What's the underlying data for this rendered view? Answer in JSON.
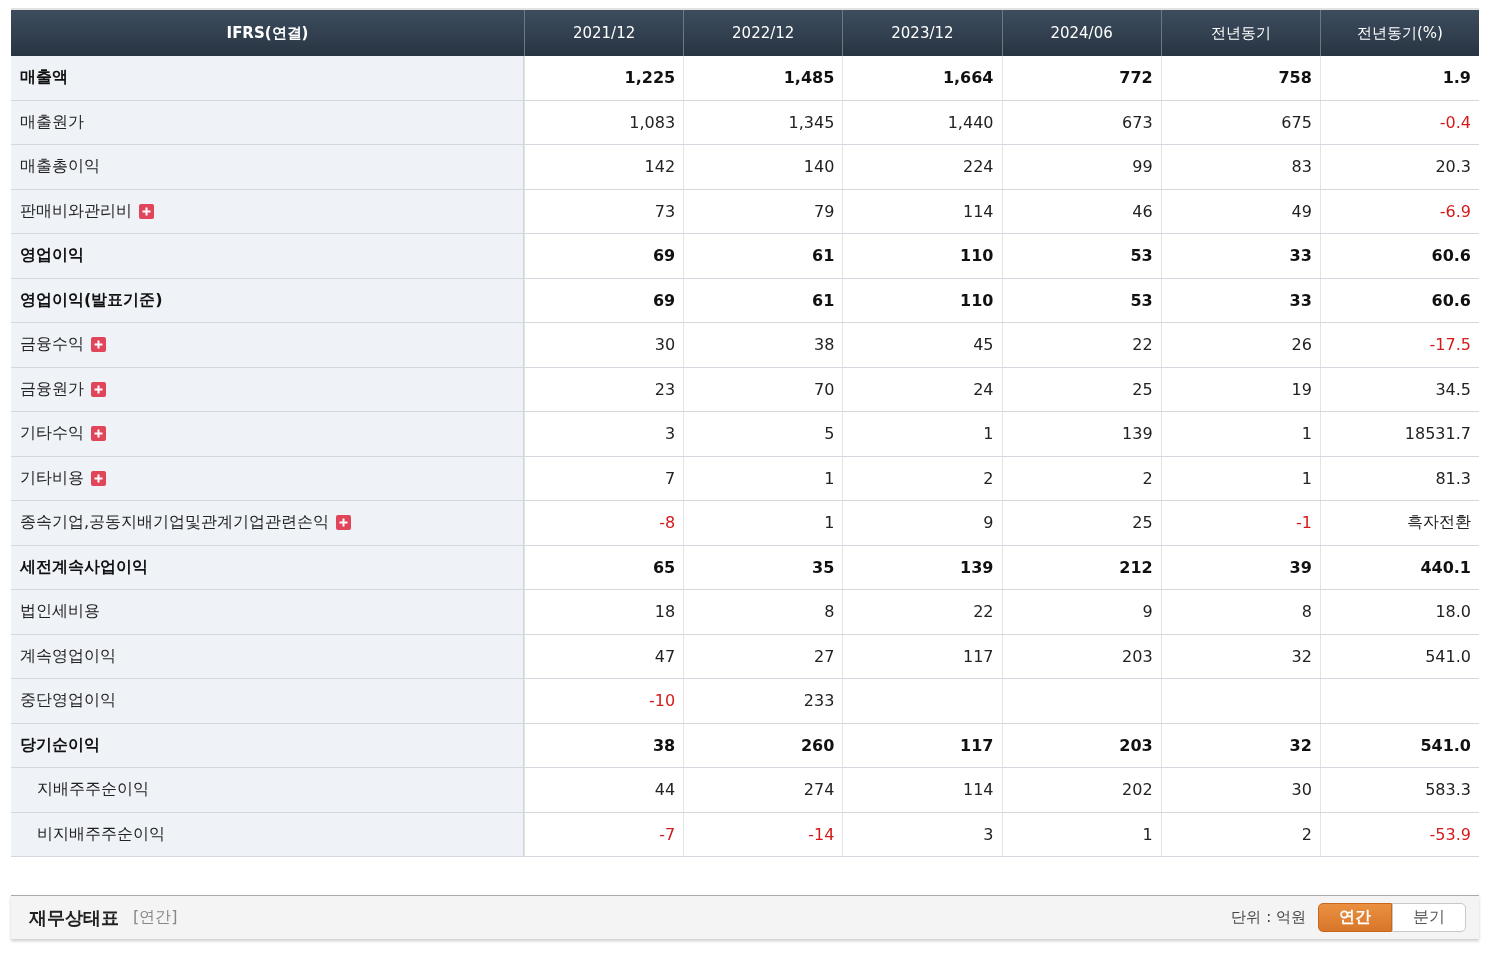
{
  "table": {
    "label_header": "IFRS(연결)",
    "columns": [
      "2021/12",
      "2022/12",
      "2023/12",
      "2024/06",
      "전년동기",
      "전년동기(%)"
    ],
    "rows": [
      {
        "label": "매출액",
        "bold": true,
        "expandable": false,
        "cells": [
          {
            "text": "1,225",
            "negative": false
          },
          {
            "text": "1,485",
            "negative": false
          },
          {
            "text": "1,664",
            "negative": false
          },
          {
            "text": "772",
            "negative": false
          },
          {
            "text": "758",
            "negative": false
          },
          {
            "text": "1.9",
            "negative": false
          }
        ]
      },
      {
        "label": "매출원가",
        "bold": false,
        "expandable": false,
        "cells": [
          {
            "text": "1,083",
            "negative": false
          },
          {
            "text": "1,345",
            "negative": false
          },
          {
            "text": "1,440",
            "negative": false
          },
          {
            "text": "673",
            "negative": false
          },
          {
            "text": "675",
            "negative": false
          },
          {
            "text": "-0.4",
            "negative": true
          }
        ]
      },
      {
        "label": "매출총이익",
        "bold": false,
        "expandable": false,
        "cells": [
          {
            "text": "142",
            "negative": false
          },
          {
            "text": "140",
            "negative": false
          },
          {
            "text": "224",
            "negative": false
          },
          {
            "text": "99",
            "negative": false
          },
          {
            "text": "83",
            "negative": false
          },
          {
            "text": "20.3",
            "negative": false
          }
        ]
      },
      {
        "label": "판매비와관리비",
        "bold": false,
        "expandable": true,
        "cells": [
          {
            "text": "73",
            "negative": false
          },
          {
            "text": "79",
            "negative": false
          },
          {
            "text": "114",
            "negative": false
          },
          {
            "text": "46",
            "negative": false
          },
          {
            "text": "49",
            "negative": false
          },
          {
            "text": "-6.9",
            "negative": true
          }
        ]
      },
      {
        "label": "영업이익",
        "bold": true,
        "expandable": false,
        "cells": [
          {
            "text": "69",
            "negative": false
          },
          {
            "text": "61",
            "negative": false
          },
          {
            "text": "110",
            "negative": false
          },
          {
            "text": "53",
            "negative": false
          },
          {
            "text": "33",
            "negative": false
          },
          {
            "text": "60.6",
            "negative": false
          }
        ]
      },
      {
        "label": "영업이익(발표기준)",
        "bold": true,
        "expandable": false,
        "cells": [
          {
            "text": "69",
            "negative": false
          },
          {
            "text": "61",
            "negative": false
          },
          {
            "text": "110",
            "negative": false
          },
          {
            "text": "53",
            "negative": false
          },
          {
            "text": "33",
            "negative": false
          },
          {
            "text": "60.6",
            "negative": false
          }
        ]
      },
      {
        "label": "금융수익",
        "bold": false,
        "expandable": true,
        "cells": [
          {
            "text": "30",
            "negative": false
          },
          {
            "text": "38",
            "negative": false
          },
          {
            "text": "45",
            "negative": false
          },
          {
            "text": "22",
            "negative": false
          },
          {
            "text": "26",
            "negative": false
          },
          {
            "text": "-17.5",
            "negative": true
          }
        ]
      },
      {
        "label": "금융원가",
        "bold": false,
        "expandable": true,
        "cells": [
          {
            "text": "23",
            "negative": false
          },
          {
            "text": "70",
            "negative": false
          },
          {
            "text": "24",
            "negative": false
          },
          {
            "text": "25",
            "negative": false
          },
          {
            "text": "19",
            "negative": false
          },
          {
            "text": "34.5",
            "negative": false
          }
        ]
      },
      {
        "label": "기타수익",
        "bold": false,
        "expandable": true,
        "cells": [
          {
            "text": "3",
            "negative": false
          },
          {
            "text": "5",
            "negative": false
          },
          {
            "text": "1",
            "negative": false
          },
          {
            "text": "139",
            "negative": false
          },
          {
            "text": "1",
            "negative": false
          },
          {
            "text": "18531.7",
            "negative": false
          }
        ]
      },
      {
        "label": "기타비용",
        "bold": false,
        "expandable": true,
        "cells": [
          {
            "text": "7",
            "negative": false
          },
          {
            "text": "1",
            "negative": false
          },
          {
            "text": "2",
            "negative": false
          },
          {
            "text": "2",
            "negative": false
          },
          {
            "text": "1",
            "negative": false
          },
          {
            "text": "81.3",
            "negative": false
          }
        ]
      },
      {
        "label": "종속기업,공동지배기업및관계기업관련손익",
        "bold": false,
        "expandable": true,
        "cells": [
          {
            "text": "-8",
            "negative": true
          },
          {
            "text": "1",
            "negative": false
          },
          {
            "text": "9",
            "negative": false
          },
          {
            "text": "25",
            "negative": false
          },
          {
            "text": "-1",
            "negative": true
          },
          {
            "text": "흑자전환",
            "negative": false
          }
        ]
      },
      {
        "label": "세전계속사업이익",
        "bold": true,
        "expandable": false,
        "cells": [
          {
            "text": "65",
            "negative": false
          },
          {
            "text": "35",
            "negative": false
          },
          {
            "text": "139",
            "negative": false
          },
          {
            "text": "212",
            "negative": false
          },
          {
            "text": "39",
            "negative": false
          },
          {
            "text": "440.1",
            "negative": false
          }
        ]
      },
      {
        "label": "법인세비용",
        "bold": false,
        "expandable": false,
        "cells": [
          {
            "text": "18",
            "negative": false
          },
          {
            "text": "8",
            "negative": false
          },
          {
            "text": "22",
            "negative": false
          },
          {
            "text": "9",
            "negative": false
          },
          {
            "text": "8",
            "negative": false
          },
          {
            "text": "18.0",
            "negative": false
          }
        ]
      },
      {
        "label": "계속영업이익",
        "bold": false,
        "expandable": false,
        "cells": [
          {
            "text": "47",
            "negative": false
          },
          {
            "text": "27",
            "negative": false
          },
          {
            "text": "117",
            "negative": false
          },
          {
            "text": "203",
            "negative": false
          },
          {
            "text": "32",
            "negative": false
          },
          {
            "text": "541.0",
            "negative": false
          }
        ]
      },
      {
        "label": "중단영업이익",
        "bold": false,
        "expandable": false,
        "cells": [
          {
            "text": "-10",
            "negative": true
          },
          {
            "text": "233",
            "negative": false
          }
        ]
      },
      {
        "label": "당기순이익",
        "bold": true,
        "expandable": false,
        "cells": [
          {
            "text": "38",
            "negative": false
          },
          {
            "text": "260",
            "negative": false
          },
          {
            "text": "117",
            "negative": false
          },
          {
            "text": "203",
            "negative": false
          },
          {
            "text": "32",
            "negative": false
          },
          {
            "text": "541.0",
            "negative": false
          }
        ],
        "children": [
          {
            "label": "지배주주순이익",
            "bold": false,
            "expandable": false,
            "cells": [
              {
                "text": "44",
                "negative": false
              },
              {
                "text": "274",
                "negative": false
              },
              {
                "text": "114",
                "negative": false
              },
              {
                "text": "202",
                "negative": false
              },
              {
                "text": "30",
                "negative": false
              },
              {
                "text": "583.3",
                "negative": false
              }
            ]
          },
          {
            "label": "비지배주주순이익",
            "bold": false,
            "expandable": false,
            "cells": [
              {
                "text": "-7",
                "negative": true
              },
              {
                "text": "-14",
                "negative": true
              },
              {
                "text": "3",
                "negative": false
              },
              {
                "text": "1",
                "negative": false
              },
              {
                "text": "2",
                "negative": false
              },
              {
                "text": "-53.9",
                "negative": true
              }
            ]
          }
        ]
      }
    ]
  },
  "section": {
    "title": "재무상태표",
    "period": "[연간]",
    "unit": "단위 : 억원",
    "toggles": [
      {
        "label": "연간",
        "selected": true
      },
      {
        "label": "분기",
        "selected": false
      }
    ]
  }
}
